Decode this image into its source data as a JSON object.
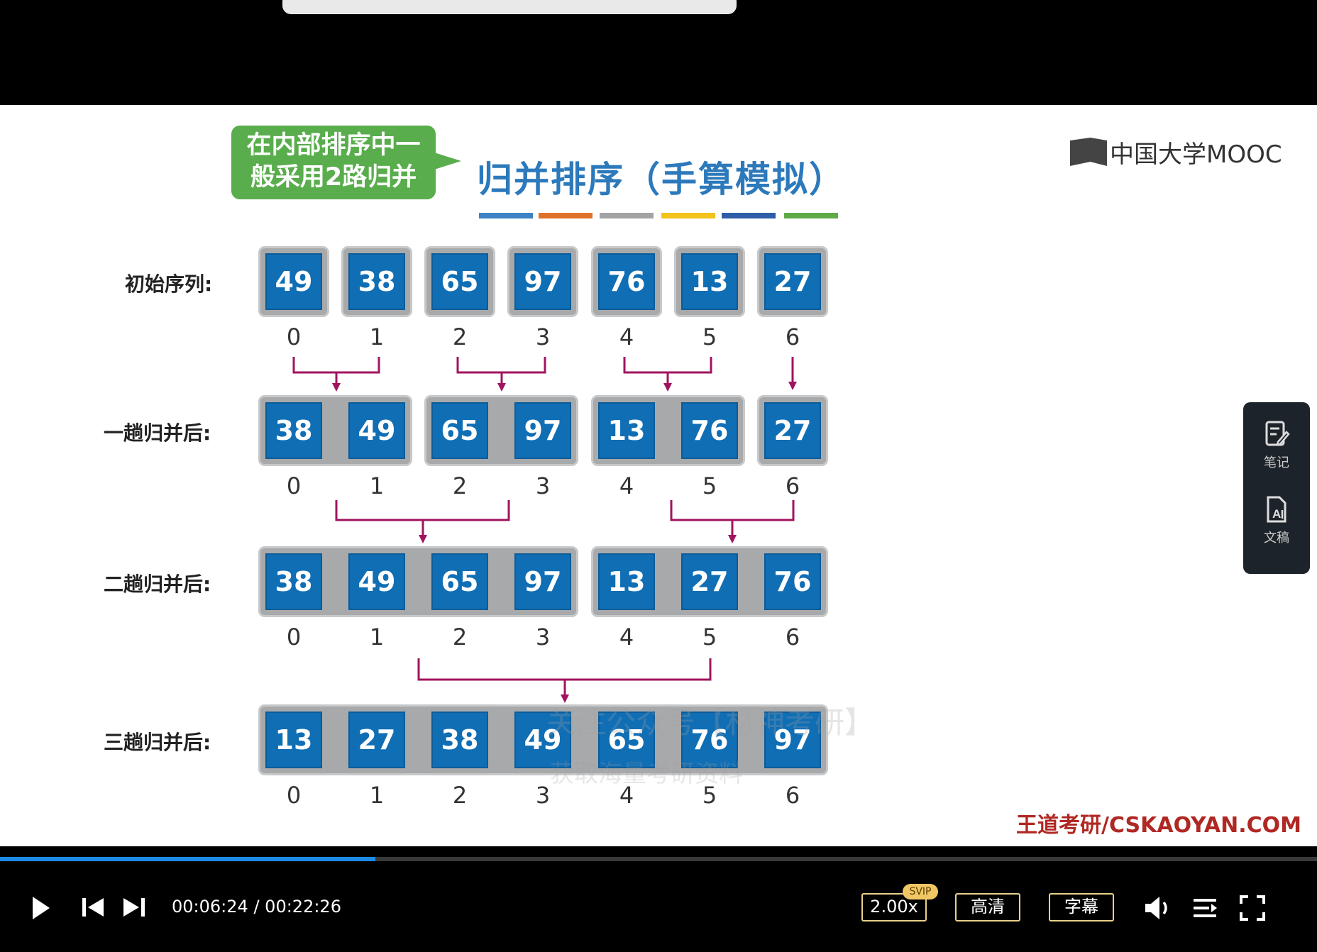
{
  "slide": {
    "callout_line1": "在内部排序中一",
    "callout_line2": "般采用2路归并",
    "title": "归并排序（手算模拟）",
    "logo_text": "中国大学MOOC",
    "watermark_line1": "关注公众号【材神考研】",
    "watermark_line2": "获取海量考研资料",
    "footer_brand": "王道考研/CSKAOYAN.COM",
    "title_bar_colors": [
      "#3d82c4",
      "#e0712a",
      "#a3a3a3",
      "#f2c21b",
      "#2f5da8",
      "#5eab45"
    ],
    "rows": [
      {
        "label": "初始序列:",
        "values": [
          "49",
          "38",
          "65",
          "97",
          "76",
          "13",
          "27"
        ],
        "groups": [
          [
            0,
            0
          ],
          [
            1,
            1
          ],
          [
            2,
            2
          ],
          [
            3,
            3
          ],
          [
            4,
            4
          ],
          [
            5,
            5
          ],
          [
            6,
            6
          ]
        ]
      },
      {
        "label": "一趟归并后:",
        "values": [
          "38",
          "49",
          "65",
          "97",
          "13",
          "76",
          "27"
        ],
        "groups": [
          [
            0,
            1
          ],
          [
            2,
            3
          ],
          [
            4,
            5
          ],
          [
            6,
            6
          ]
        ]
      },
      {
        "label": "二趟归并后:",
        "values": [
          "38",
          "49",
          "65",
          "97",
          "13",
          "27",
          "76"
        ],
        "groups": [
          [
            0,
            3
          ],
          [
            4,
            6
          ]
        ]
      },
      {
        "label": "三趟归并后:",
        "values": [
          "13",
          "27",
          "38",
          "49",
          "65",
          "76",
          "97"
        ],
        "groups": [
          [
            0,
            6
          ]
        ]
      }
    ],
    "indices": [
      "0",
      "1",
      "2",
      "3",
      "4",
      "5",
      "6"
    ]
  },
  "side_panel": {
    "notes_label": "笔记",
    "notes_icon": "note-edit-icon",
    "transcript_label": "文稿",
    "transcript_icon": "document-ai-icon"
  },
  "player": {
    "current_time": "00:06:24",
    "separator": "/",
    "total_time": "00:22:26",
    "progress": 0.285,
    "speed": "2.00x",
    "speed_badge": "SVIP",
    "quality": "高清",
    "subtitles": "字幕",
    "accent_color": "#1d8ae8"
  }
}
